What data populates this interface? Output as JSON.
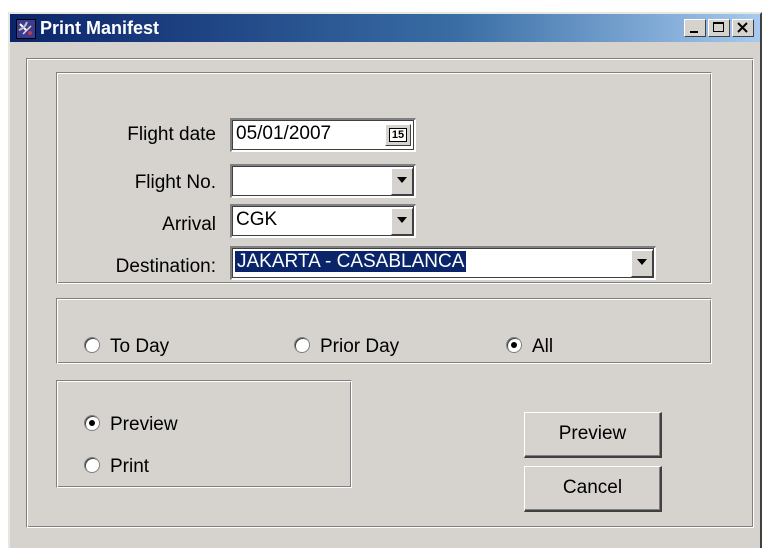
{
  "window": {
    "title": "Print Manifest",
    "icon": "satellite-dish-icon",
    "controls": [
      "minimize-icon",
      "maximize-icon",
      "close-icon"
    ]
  },
  "form": {
    "flight_date": {
      "label": "Flight date",
      "value": "05/01/2007",
      "calendar_label": "15"
    },
    "flight_no": {
      "label": "Flight No.",
      "value": ""
    },
    "arrival": {
      "label": "Arrival",
      "value": "CGK"
    },
    "destination": {
      "label": "Destination:",
      "value": "JAKARTA - CASABLANCA"
    }
  },
  "day_filter": {
    "options": [
      {
        "label": "To Day",
        "selected": false
      },
      {
        "label": "Prior Day",
        "selected": false
      },
      {
        "label": "All",
        "selected": true
      }
    ]
  },
  "output_mode": {
    "options": [
      {
        "label": "Preview",
        "selected": true
      },
      {
        "label": "Print",
        "selected": false
      }
    ]
  },
  "buttons": {
    "preview": "Preview",
    "cancel": "Cancel"
  },
  "colors": {
    "title_bar": "#0a246a",
    "selection": "#0a246a",
    "face": "#d6d3ce"
  }
}
